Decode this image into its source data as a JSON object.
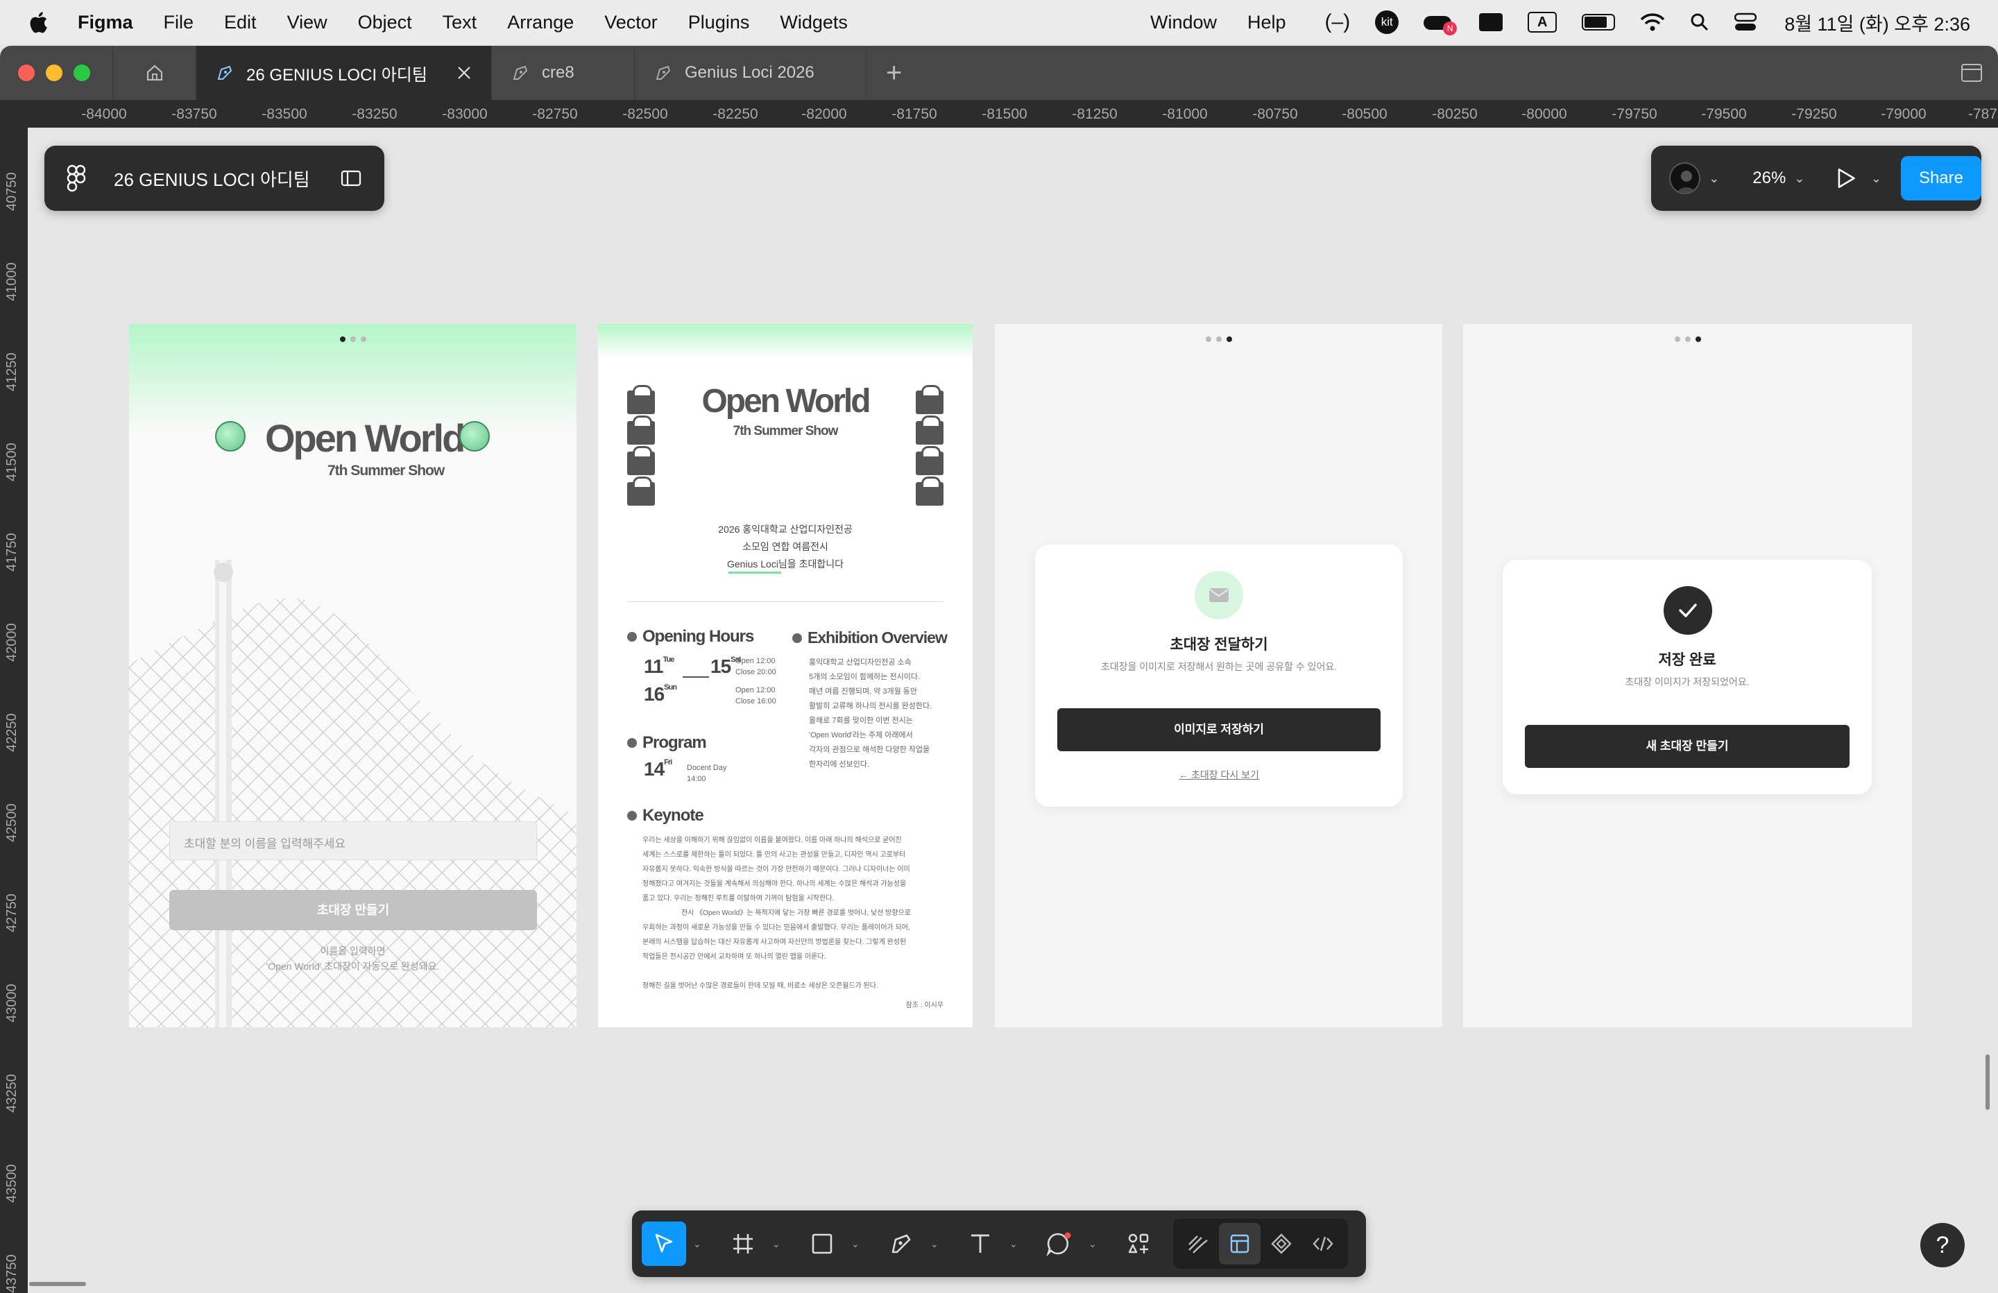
{
  "menubar": {
    "app": "Figma",
    "items": [
      "File",
      "Edit",
      "View",
      "Object",
      "Text",
      "Arrange",
      "Vector",
      "Plugins",
      "Widgets"
    ],
    "right_items": [
      "Window",
      "Help"
    ],
    "kit_label": "kit",
    "badge": "N",
    "input_label": "A",
    "clock": "8월 11일 (화) 오후 2:36"
  },
  "tabs": [
    {
      "label": "26 GENIUS LOCI 아디팀",
      "active": true
    },
    {
      "label": "cre8",
      "active": false
    },
    {
      "label": "Genius Loci 2026",
      "active": false
    }
  ],
  "ruler": {
    "x_ticks": [
      "-84000",
      "-83750",
      "-83500",
      "-83250",
      "-83000",
      "-82750",
      "-82500",
      "-82250",
      "-82000",
      "-81750",
      "-81500",
      "-81250",
      "-81000",
      "-80750",
      "-80500",
      "-80250",
      "-80000",
      "-79750",
      "-79500",
      "-79250",
      "-79000",
      "-787"
    ],
    "y_ticks": [
      "40750",
      "41000",
      "41250",
      "41500",
      "41750",
      "42000",
      "42250",
      "42500",
      "42750",
      "43000",
      "43250",
      "43500",
      "43750"
    ]
  },
  "file": {
    "name": "26 GENIUS LOCI 아디팀"
  },
  "view": {
    "zoom": "26%",
    "share": "Share"
  },
  "frame1": {
    "title": "Open World",
    "subtitle": "7th Summer Show",
    "input_placeholder": "초대할 분의 이름을 입력해주세요",
    "button": "초대장 만들기",
    "hint1": "이름을 입력하면",
    "hint2": "'Open World' 초대장이 자동으로 완성돼요."
  },
  "frame2": {
    "title": "Open World",
    "subtitle": "7th Summer Show",
    "intro1": "2026 홍익대학교 산업디자인전공",
    "intro2": "소모임 연합 여름전시",
    "intro3": "Genius Loci님을 초대합니다",
    "opening_hours": "Opening Hours",
    "date1_a": "11",
    "date1_a_sup": "Tue",
    "date1_b": "15",
    "date1_b_sup": "Sat",
    "date1_open": "Open 12:00",
    "date1_close": "Close 20:00",
    "date2": "16",
    "date2_sup": "Sun",
    "date2_open": "Open 12:00",
    "date2_close": "Close 16:00",
    "program": "Program",
    "date3": "14",
    "date3_sup": "Fri",
    "docent": "Docent Day",
    "docent_time": "14:00",
    "exhibition": "Exhibition Overview",
    "exh_lines": [
      "홍익대학교 산업디자인전공 소속",
      "5개의 소모임이 함께하는 전시이다.",
      "매년 여름 진행되며, 약 3개월 동안",
      "활발히 교류해 하나의 전시를 완성한다.",
      "올해로 7회를 맞이한 이번 전시는",
      "'Open World'라는 주제 아래에서",
      "각자의 관점으로 해석한 다양한 작업을",
      "한자리에 선보인다."
    ],
    "keynote": "Keynote",
    "key_lines": [
      "우리는 세상을 이해하기 위해 끊임없이 이름을 붙여왔다. 이름 아래 하나의 해석으로 굳어진",
      "세계는 스스로를 제한하는 틀이 되었다. 틀 안의 사고는 관성을 만들고, 디자인 역시 고로부터",
      "자유롭지 못하다. 익숙한 방식을 따르는 것이 가장 안전하기 때문이다. 그러나 디자이너는 이미",
      "정해졌다고 여겨지는 것들을 계속해서 의심해야 한다. 하나의 세계는 수많은 해석과 가능성을",
      "품고 있다. 우리는 정해진 루트를 이탈하여 기꺼이 탐험을 시작한다.",
      "전시 《Open World》는 목적지에 닿는 가장 빠른 경로를 벗어나, 낯선 방향으로",
      "우회하는 과정이 새로운 가능성을 만들 수 있다는 믿음에서 출발했다. 우리는 플레이어가 되어,",
      "본래의 시스템을 답습하는 대신 자유롭게 사고하며 자신만의 방법론을 찾는다. 그렇게 완성된",
      "작업들은 전시공간 안에서 교차하며 또 하나의 열린 맵을 이룬다.",
      "",
      "정해진 길을 벗어난 수많은 경로들이 한데 모일 때, 비로소 세상은 오픈월드가 된다."
    ],
    "credit": "참조 : 이시우"
  },
  "frame3": {
    "title": "초대장 전달하기",
    "desc": "초대장을 이미지로 저장해서 원하는 곳에 공유할 수 있어요.",
    "button": "이미지로 저장하기",
    "link": "← 초대장 다시 보기"
  },
  "frame4": {
    "title": "저장 완료",
    "desc": "초대장 이미지가 저장되었어요.",
    "button": "새 초대장 만들기"
  },
  "help": "?",
  "colors": {
    "accent": "#0d99ff",
    "mint": "#b4f7c8",
    "dark": "#2c2c2c"
  }
}
